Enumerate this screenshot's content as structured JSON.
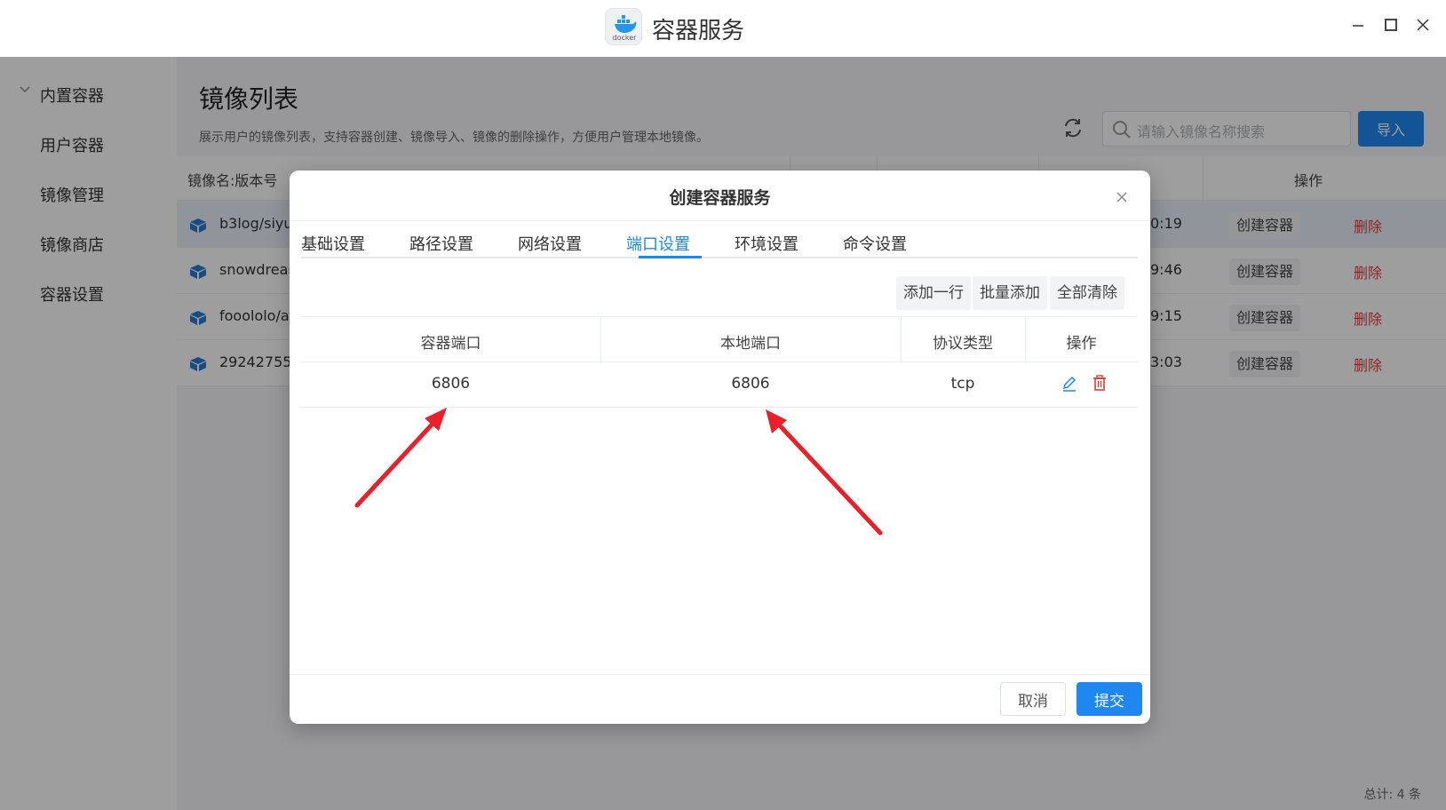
{
  "window": {
    "title": "容器服务",
    "logo_text": "docker",
    "controls": [
      "minimize-icon",
      "maximize-icon",
      "close-icon"
    ]
  },
  "sidebar": {
    "group_label": "内置容器",
    "items": [
      {
        "label": "用户容器"
      },
      {
        "label": "镜像管理"
      },
      {
        "label": "镜像商店"
      },
      {
        "label": "容器设置"
      }
    ]
  },
  "page": {
    "title": "镜像列表",
    "description": "展示用户的镜像列表，支持容器创建、镜像导入、镜像的删除操作，方便用户管理本地镜像。",
    "search_placeholder": "请输入镜像名称搜索",
    "import_label": "导入",
    "columns": {
      "name": "镜像名:版本号",
      "actions": "操作"
    },
    "rows": [
      {
        "name": "b3log/siyua",
        "time": "0:19",
        "create_label": "创建容器",
        "delete_label": "删除",
        "selected": true
      },
      {
        "name": "snowdream",
        "time": "9:46",
        "create_label": "创建容器",
        "delete_label": "删除",
        "selected": false
      },
      {
        "name": "fooololo/aip",
        "time": "9:15",
        "create_label": "创建容器",
        "delete_label": "删除",
        "selected": false
      },
      {
        "name": "292427558",
        "time": "3:03",
        "create_label": "创建容器",
        "delete_label": "删除",
        "selected": false
      }
    ],
    "total": "总计: 4 条"
  },
  "modal": {
    "title": "创建容器服务",
    "tabs": [
      {
        "label": "基础设置",
        "active": false
      },
      {
        "label": "路径设置",
        "active": false
      },
      {
        "label": "网络设置",
        "active": false
      },
      {
        "label": "端口设置",
        "active": true
      },
      {
        "label": "环境设置",
        "active": false
      },
      {
        "label": "命令设置",
        "active": false
      }
    ],
    "toolbar": {
      "add_row": "添加一行",
      "batch_add": "批量添加",
      "clear_all": "全部清除"
    },
    "table": {
      "headers": {
        "container_port": "容器端口",
        "local_port": "本地端口",
        "protocol": "协议类型",
        "actions": "操作"
      },
      "rows": [
        {
          "container_port": "6806",
          "local_port": "6806",
          "protocol": "tcp"
        }
      ]
    },
    "cancel_label": "取消",
    "submit_label": "提交"
  },
  "colors": {
    "accent": "#1e88f0",
    "danger": "#e23b3b",
    "annotation_arrow": "#e8202a"
  }
}
